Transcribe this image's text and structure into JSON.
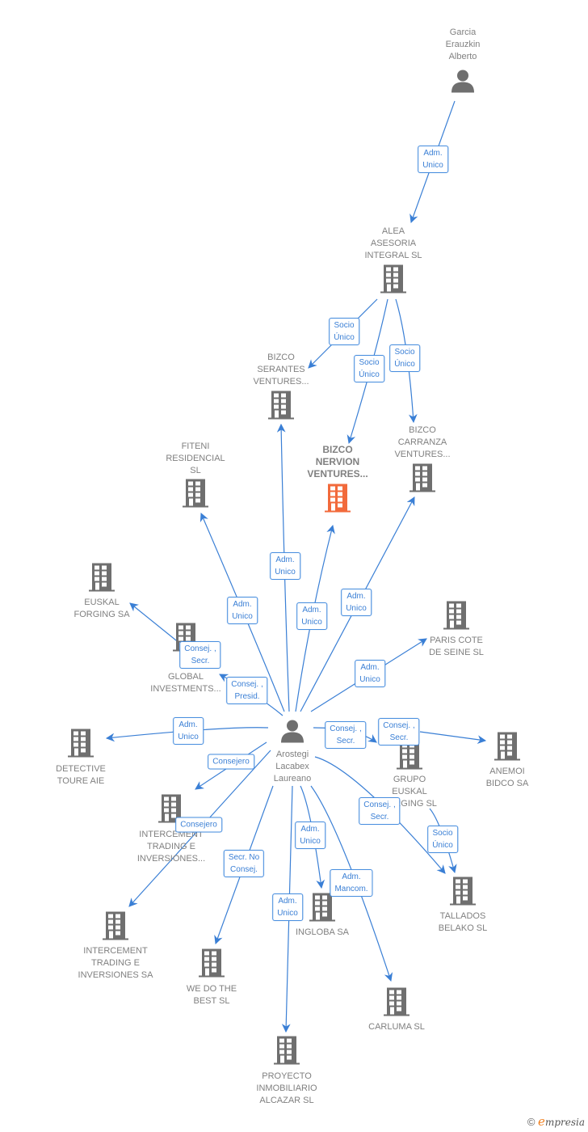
{
  "colors": {
    "edge": "#3a7fd5",
    "icon": "#6f6f6f",
    "icon_highlight": "#f26a3b",
    "text": "#808080"
  },
  "nodes": [
    {
      "id": "garcia",
      "type": "person",
      "lines": [
        "Garcia",
        "Erauzkin",
        "Alberto"
      ]
    },
    {
      "id": "alea",
      "type": "company",
      "lines": [
        "ALEA",
        "ASESORIA",
        "INTEGRAL  SL"
      ]
    },
    {
      "id": "serantes",
      "type": "company",
      "lines": [
        "BIZCO",
        "SERANTES",
        "VENTURES..."
      ]
    },
    {
      "id": "nervion",
      "type": "company",
      "highlight": true,
      "lines": [
        "BIZCO",
        "NERVION",
        "VENTURES..."
      ]
    },
    {
      "id": "carranza",
      "type": "company",
      "lines": [
        "BIZCO",
        "CARRANZA",
        "VENTURES..."
      ]
    },
    {
      "id": "fiteni",
      "type": "company",
      "lines": [
        "FITENI",
        "RESIDENCIAL",
        "SL"
      ]
    },
    {
      "id": "euskalforging",
      "type": "company",
      "lines": [
        "EUSKAL",
        "FORGING SA"
      ]
    },
    {
      "id": "global",
      "type": "company",
      "lines": [
        "GLOBAL",
        "INVESTMENTS..."
      ]
    },
    {
      "id": "paris",
      "type": "company",
      "lines": [
        "PARIS COTE",
        "DE SEINE SL"
      ]
    },
    {
      "id": "arostegi",
      "type": "person",
      "lines": [
        "Arostegi",
        "Lacabex",
        "Laureano"
      ]
    },
    {
      "id": "detective",
      "type": "company",
      "lines": [
        "DETECTIVE",
        "TOURE  AIE"
      ]
    },
    {
      "id": "grupo",
      "type": "company",
      "lines": [
        "GRUPO",
        "EUSKAL",
        "FORGING  SL"
      ]
    },
    {
      "id": "anemoi",
      "type": "company",
      "lines": [
        "ANEMOI",
        "BIDCO SA"
      ]
    },
    {
      "id": "intercement1",
      "type": "company",
      "lines": [
        "INTERCEMENT",
        "TRADING E",
        "INVERSIONES..."
      ]
    },
    {
      "id": "intercement2",
      "type": "company",
      "lines": [
        "INTERCEMENT",
        "TRADING E",
        "INVERSIONES SA"
      ]
    },
    {
      "id": "wedo",
      "type": "company",
      "lines": [
        "WE DO THE",
        "BEST  SL"
      ]
    },
    {
      "id": "ingloba",
      "type": "company",
      "lines": [
        "INGLOBA SA"
      ]
    },
    {
      "id": "tallados",
      "type": "company",
      "lines": [
        "TALLADOS",
        "BELAKO  SL"
      ]
    },
    {
      "id": "carluma",
      "type": "company",
      "lines": [
        "CARLUMA SL"
      ]
    },
    {
      "id": "proyecto",
      "type": "company",
      "lines": [
        "PROYECTO",
        "INMOBILIARIO",
        "ALCAZAR SL"
      ]
    }
  ],
  "edges": [
    {
      "from": "garcia",
      "to": "alea",
      "label": [
        "Adm.",
        "Unico"
      ]
    },
    {
      "from": "alea",
      "to": "serantes",
      "label": [
        "Socio",
        "Único"
      ]
    },
    {
      "from": "alea",
      "to": "nervion",
      "label": [
        "Socio",
        "Único"
      ]
    },
    {
      "from": "alea",
      "to": "carranza",
      "label": [
        "Socio",
        "Único"
      ]
    },
    {
      "from": "arostegi",
      "to": "serantes",
      "label": [
        "Adm.",
        "Unico"
      ]
    },
    {
      "from": "arostegi",
      "to": "fiteni",
      "label": [
        "Adm.",
        "Unico"
      ]
    },
    {
      "from": "arostegi",
      "to": "nervion",
      "label": [
        "Adm.",
        "Unico"
      ]
    },
    {
      "from": "arostegi",
      "to": "carranza",
      "label": [
        "Adm.",
        "Unico"
      ]
    },
    {
      "from": "arostegi",
      "to": "paris",
      "label": [
        "Adm.",
        "Unico"
      ]
    },
    {
      "from": "global",
      "to": "euskalforging",
      "label": [
        "Consej. ,",
        "Secr."
      ]
    },
    {
      "from": "arostegi",
      "to": "global",
      "label": [
        "Consej. ,",
        "Presid."
      ]
    },
    {
      "from": "arostegi",
      "to": "detective",
      "label": [
        "Adm.",
        "Unico"
      ]
    },
    {
      "from": "arostegi",
      "to": "grupo",
      "label": [
        "Consej. ,",
        "Secr."
      ]
    },
    {
      "from": "grupo",
      "to": "anemoi",
      "label": [
        "Consej. ,",
        "Secr."
      ]
    },
    {
      "from": "arostegi",
      "to": "intercement1",
      "label": [
        "Consejero"
      ]
    },
    {
      "from": "arostegi",
      "to": "intercement2",
      "label": [
        "Consejero"
      ]
    },
    {
      "from": "arostegi",
      "to": "wedo",
      "label": [
        "Secr.  No",
        "Consej."
      ]
    },
    {
      "from": "arostegi",
      "to": "ingloba",
      "label": [
        "Adm.",
        "Unico"
      ]
    },
    {
      "from": "arostegi",
      "to": "proyecto",
      "label": [
        "Adm.",
        "Unico"
      ]
    },
    {
      "from": "arostegi",
      "to": "carluma",
      "label": [
        "Adm.",
        "Mancom."
      ]
    },
    {
      "from": "arostegi",
      "to": "tallados",
      "label": [
        "Consej. ,",
        "Secr."
      ]
    },
    {
      "from": "grupo",
      "to": "tallados",
      "label": [
        "Socio",
        "Único"
      ]
    }
  ],
  "footer": {
    "copyright": "©",
    "brand_initial": "e",
    "brand_rest": "mpresia"
  }
}
